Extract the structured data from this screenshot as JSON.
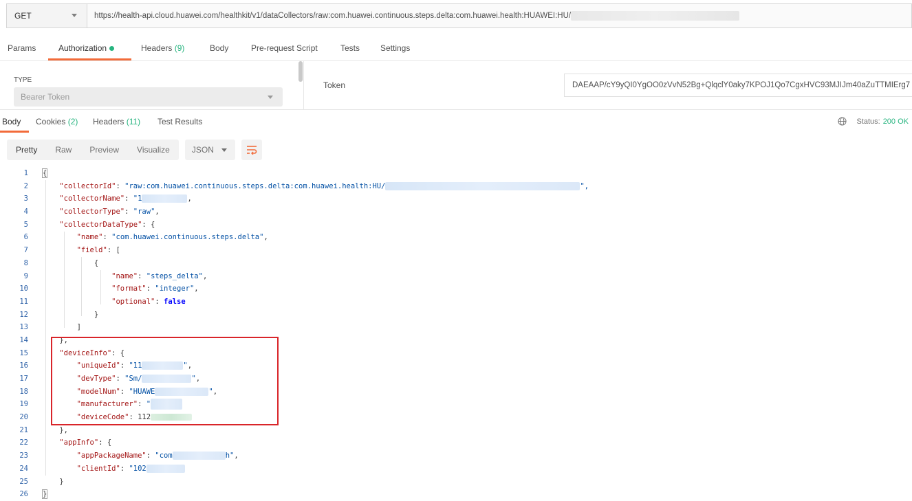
{
  "request": {
    "method": "GET",
    "url": "https://health-api.cloud.huawei.com/healthkit/v1/dataCollectors/raw:com.huawei.continuous.steps.delta:com.huawei.health:HUAWEI:HU/"
  },
  "request_tabs": [
    {
      "label": "Params"
    },
    {
      "label": "Authorization"
    },
    {
      "label": "Headers",
      "count": "(9)"
    },
    {
      "label": "Body"
    },
    {
      "label": "Pre-request Script"
    },
    {
      "label": "Tests"
    },
    {
      "label": "Settings"
    }
  ],
  "auth": {
    "type_label": "TYPE",
    "type_value": "Bearer Token",
    "token_label": "Token",
    "token_value": "DAEAAP/cY9yQI0YgOO0zVvN52Bg+QlqclY0aky7KPOJ1Qo7CgxHVC93MJIJm40aZuTTMIErg7"
  },
  "response_tabs": [
    {
      "label": "Body"
    },
    {
      "label": "Cookies",
      "count": "(2)"
    },
    {
      "label": "Headers",
      "count": "(11)"
    },
    {
      "label": "Test Results"
    }
  ],
  "status": {
    "label": "Status:",
    "value": "200 OK"
  },
  "view_modes": [
    "Pretty",
    "Raw",
    "Preview",
    "Visualize"
  ],
  "format": "JSON",
  "code": {
    "l1": "{",
    "l2k": "\"collectorId\"",
    "l2v": "\"raw:com.huawei.continuous.steps.delta:com.huawei.health:HU/",
    "l3k": "\"collectorName\"",
    "l3v": "\"1",
    "l4k": "\"collectorType\"",
    "l4v": "\"raw\"",
    "l5k": "\"collectorDataType\"",
    "l6k": "\"name\"",
    "l6v": "\"com.huawei.continuous.steps.delta\"",
    "l7k": "\"field\"",
    "l9k": "\"name\"",
    "l9v": "\"steps_delta\"",
    "l10k": "\"format\"",
    "l10v": "\"integer\"",
    "l11k": "\"optional\"",
    "l11v": "false",
    "l15k": "\"deviceInfo\"",
    "l16k": "\"uniqueId\"",
    "l16v": "\"11",
    "l17k": "\"devType\"",
    "l17v": "\"Sm/",
    "l18k": "\"modelNum\"",
    "l18v": "\"HUAWE",
    "l19k": "\"manufacturer\"",
    "l19v": "\"",
    "l20k": "\"deviceCode\"",
    "l20v": "112",
    "l22k": "\"appInfo\"",
    "l23k": "\"appPackageName\"",
    "l23v": "\"com",
    "l23e": "h\"",
    "l24k": "\"clientId\"",
    "l24v": "\"102",
    "l26": "}"
  }
}
